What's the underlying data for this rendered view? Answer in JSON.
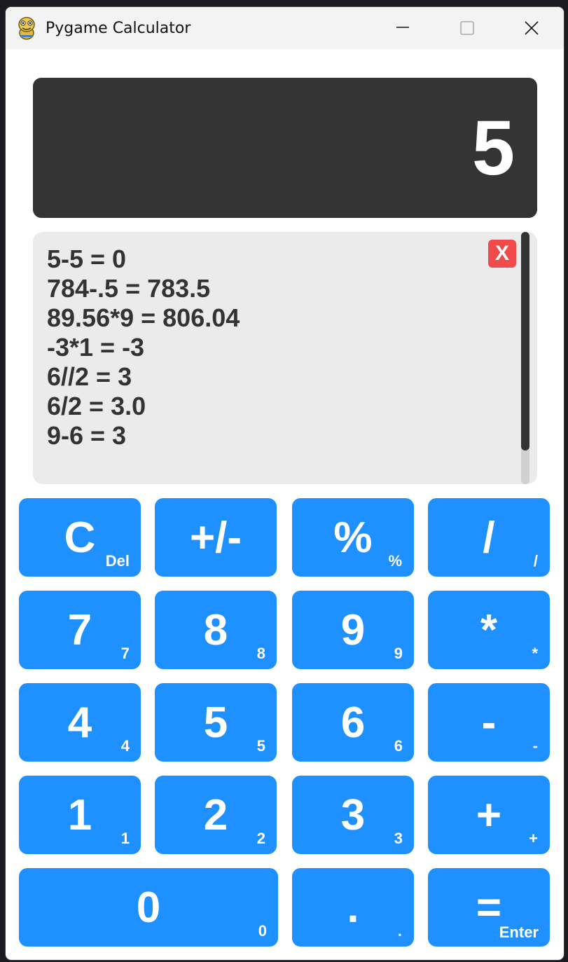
{
  "window": {
    "title": "Pygame Calculator",
    "icons": {
      "app": "pygame-snake-icon",
      "minimize": "minimize-icon",
      "maximize": "maximize-icon",
      "close": "close-icon"
    }
  },
  "display": {
    "value": "5"
  },
  "history": {
    "lines": [
      "5-5 = 0",
      "784-.5 = 783.5",
      "89.56*9 = 806.04",
      "-3*1 = -3",
      "6//2 = 3",
      "6/2 = 3.0",
      "9-6 = 3"
    ],
    "clear_label": "X"
  },
  "keys": {
    "clear": {
      "label": "C",
      "hint": "Del"
    },
    "negate": {
      "label": "+/-",
      "hint": ""
    },
    "percent": {
      "label": "%",
      "hint": "%"
    },
    "divide": {
      "label": "/",
      "hint": "/"
    },
    "seven": {
      "label": "7",
      "hint": "7"
    },
    "eight": {
      "label": "8",
      "hint": "8"
    },
    "nine": {
      "label": "9",
      "hint": "9"
    },
    "multiply": {
      "label": "*",
      "hint": "*"
    },
    "four": {
      "label": "4",
      "hint": "4"
    },
    "five": {
      "label": "5",
      "hint": "5"
    },
    "six": {
      "label": "6",
      "hint": "6"
    },
    "subtract": {
      "label": "-",
      "hint": "-"
    },
    "one": {
      "label": "1",
      "hint": "1"
    },
    "two": {
      "label": "2",
      "hint": "2"
    },
    "three": {
      "label": "3",
      "hint": "3"
    },
    "add": {
      "label": "+",
      "hint": "+"
    },
    "zero": {
      "label": "0",
      "hint": "0"
    },
    "decimal": {
      "label": ".",
      "hint": "."
    },
    "equals": {
      "label": "=",
      "hint": "Enter"
    }
  },
  "colors": {
    "key_bg": "#1e90ff",
    "display_bg": "#343434",
    "history_bg": "#ebebeb",
    "clear_history": "#f04a4a"
  }
}
